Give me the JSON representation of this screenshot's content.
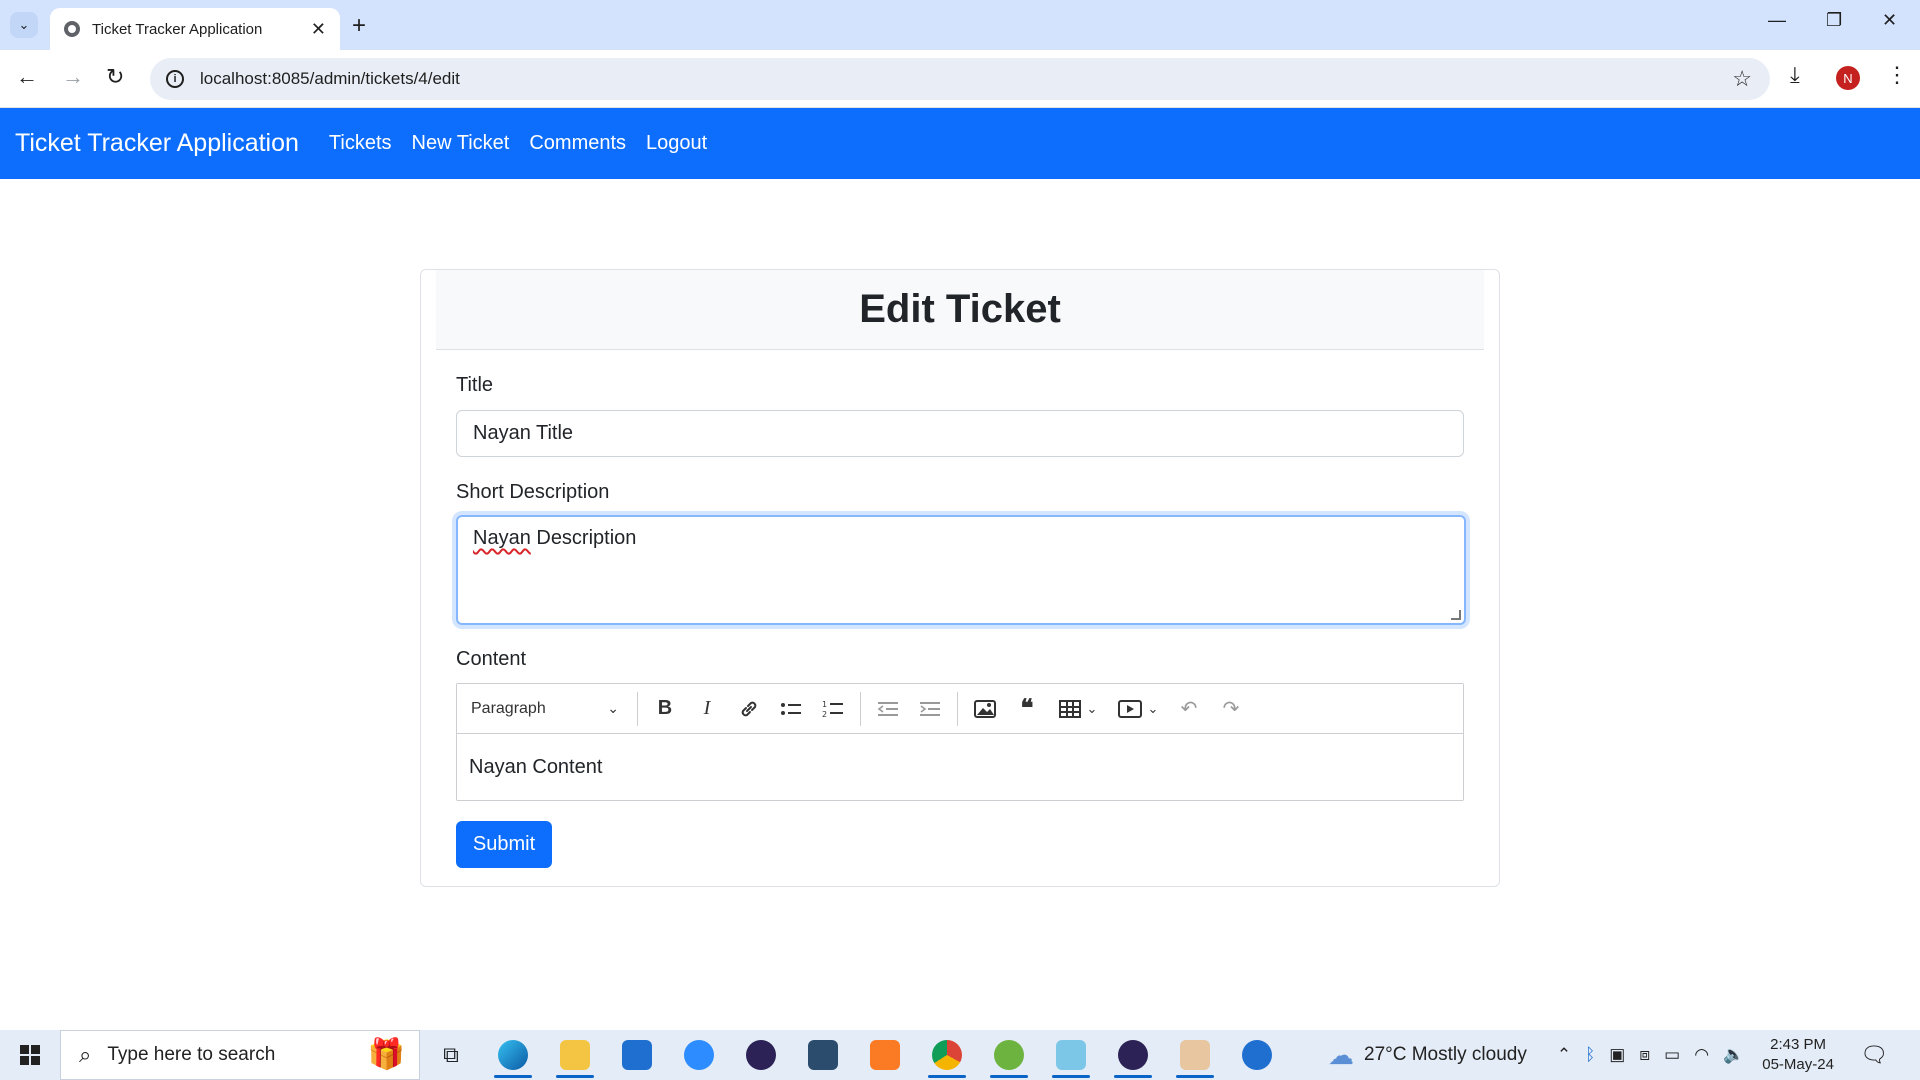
{
  "browser": {
    "tab_title": "Ticket Tracker Application",
    "url": "localhost:8085/admin/tickets/4/edit",
    "profile_initial": "N"
  },
  "navbar": {
    "brand": "Ticket Tracker Application",
    "links": [
      "Tickets",
      "New Ticket",
      "Comments",
      "Logout"
    ]
  },
  "form": {
    "heading": "Edit Ticket",
    "title_label": "Title",
    "title_value": "Nayan Title",
    "short_desc_label": "Short Description",
    "short_desc_word1": "Nayan",
    "short_desc_word2": " Description",
    "content_label": "Content",
    "editor_paragraph": "Paragraph",
    "content_value": "Nayan Content",
    "submit_label": "Submit"
  },
  "taskbar": {
    "search_placeholder": "Type here to search",
    "weather": "27°C  Mostly cloudy",
    "time": "2:43 PM",
    "date": "05-May-24"
  },
  "colors": {
    "primary": "#0d6efd",
    "tabbar": "#d3e3fd"
  }
}
